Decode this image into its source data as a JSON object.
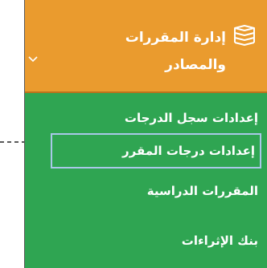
{
  "sidebar": {
    "section": {
      "title": "إدارة المقررات والمصادر",
      "icon": "books-stack-icon",
      "expanded": true,
      "bg_color": "#ea9b2e"
    },
    "items": [
      {
        "label": "إعدادات سجل الدرجات",
        "active": false
      },
      {
        "label": "إعدادات درجات المقرر",
        "active": true
      },
      {
        "label": "المقررات الدراسية",
        "active": false
      },
      {
        "label": "بنك الإثراءات",
        "active": false
      }
    ],
    "menu_bg_color": "#2fa552",
    "highlight_color": "#a9c8e8"
  }
}
